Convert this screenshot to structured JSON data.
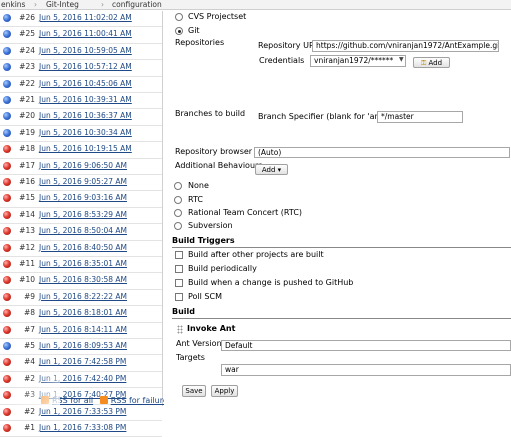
{
  "breadcrumb": {
    "items": [
      "enkins",
      "Git-Integ",
      "configuration"
    ],
    "separator": "›"
  },
  "build_history": {
    "builds": [
      {
        "number": "#26",
        "date": "Jun 5, 2016 11:02:02 AM",
        "status": "blue"
      },
      {
        "number": "#25",
        "date": "Jun 5, 2016 11:00:41 AM",
        "status": "blue"
      },
      {
        "number": "#24",
        "date": "Jun 5, 2016 10:59:05 AM",
        "status": "blue"
      },
      {
        "number": "#23",
        "date": "Jun 5, 2016 10:57:12 AM",
        "status": "blue"
      },
      {
        "number": "#22",
        "date": "Jun 5, 2016 10:45:06 AM",
        "status": "blue"
      },
      {
        "number": "#21",
        "date": "Jun 5, 2016 10:39:31 AM",
        "status": "blue"
      },
      {
        "number": "#20",
        "date": "Jun 5, 2016 10:36:37 AM",
        "status": "blue"
      },
      {
        "number": "#19",
        "date": "Jun 5, 2016 10:30:34 AM",
        "status": "blue"
      },
      {
        "number": "#18",
        "date": "Jun 5, 2016 10:19:15 AM",
        "status": "red"
      },
      {
        "number": "#17",
        "date": "Jun 5, 2016 9:06:50 AM",
        "status": "red"
      },
      {
        "number": "#16",
        "date": "Jun 5, 2016 9:05:27 AM",
        "status": "red"
      },
      {
        "number": "#15",
        "date": "Jun 5, 2016 9:03:16 AM",
        "status": "red"
      },
      {
        "number": "#14",
        "date": "Jun 5, 2016 8:53:29 AM",
        "status": "red"
      },
      {
        "number": "#13",
        "date": "Jun 5, 2016 8:50:04 AM",
        "status": "red"
      },
      {
        "number": "#12",
        "date": "Jun 5, 2016 8:40:50 AM",
        "status": "red"
      },
      {
        "number": "#11",
        "date": "Jun 5, 2016 8:35:01 AM",
        "status": "red"
      },
      {
        "number": "#10",
        "date": "Jun 5, 2016 8:30:58 AM",
        "status": "red"
      },
      {
        "number": "#9",
        "date": "Jun 5, 2016 8:22:22 AM",
        "status": "red"
      },
      {
        "number": "#8",
        "date": "Jun 5, 2016 8:18:01 AM",
        "status": "red"
      },
      {
        "number": "#7",
        "date": "Jun 5, 2016 8:14:11 AM",
        "status": "red"
      },
      {
        "number": "#5",
        "date": "Jun 5, 2016 8:09:53 AM",
        "status": "blue"
      },
      {
        "number": "#4",
        "date": "Jun 1, 2016 7:42:58 PM",
        "status": "red"
      },
      {
        "number": "#2",
        "date": "Jun 1, 2016 7:42:40 PM",
        "status": "red"
      },
      {
        "number": "#3",
        "date": "Jun 1, 2016 7:40:27 PM",
        "status": "red"
      },
      {
        "number": "#2",
        "date": "Jun 1, 2016 7:33:53 PM",
        "status": "red"
      },
      {
        "number": "#1",
        "date": "Jun 1, 2016 7:33:08 PM",
        "status": "red"
      }
    ],
    "rss_all": "RSS for all",
    "rss_failures": "RSS for failures"
  },
  "scm": {
    "options": [
      "CVS Projectset",
      "Git"
    ],
    "selected": "Git",
    "repositories_label": "Repositories",
    "repository_url_label": "Repository URL",
    "repository_url_value": "https://github.com/vniranjan1972/AntExample.git",
    "credentials_label": "Credentials",
    "credentials_value": "vniranjan1972/******",
    "add_button": "Add",
    "branches_label": "Branches to build",
    "branch_specifier_label": "Branch Specifier (blank for 'any')",
    "branch_specifier_value": "*/master",
    "repo_browser_label": "Repository browser",
    "repo_browser_value": "(Auto)",
    "additional_behaviours_label": "Additional Behaviours",
    "add_dropdown": "Add ▾",
    "other_scm_options": [
      "None",
      "RTC",
      "Rational Team Concert (RTC)",
      "Subversion"
    ]
  },
  "build_triggers": {
    "title": "Build Triggers",
    "options": [
      "Build after other projects are built",
      "Build periodically",
      "Build when a change is pushed to GitHub",
      "Poll SCM"
    ]
  },
  "build": {
    "title": "Build",
    "step_title": "Invoke Ant",
    "ant_version_label": "Ant Version",
    "ant_version_value": "Default",
    "targets_label": "Targets",
    "targets_value": "war"
  },
  "footer": {
    "save_button": "Save",
    "apply_button": "Apply"
  }
}
